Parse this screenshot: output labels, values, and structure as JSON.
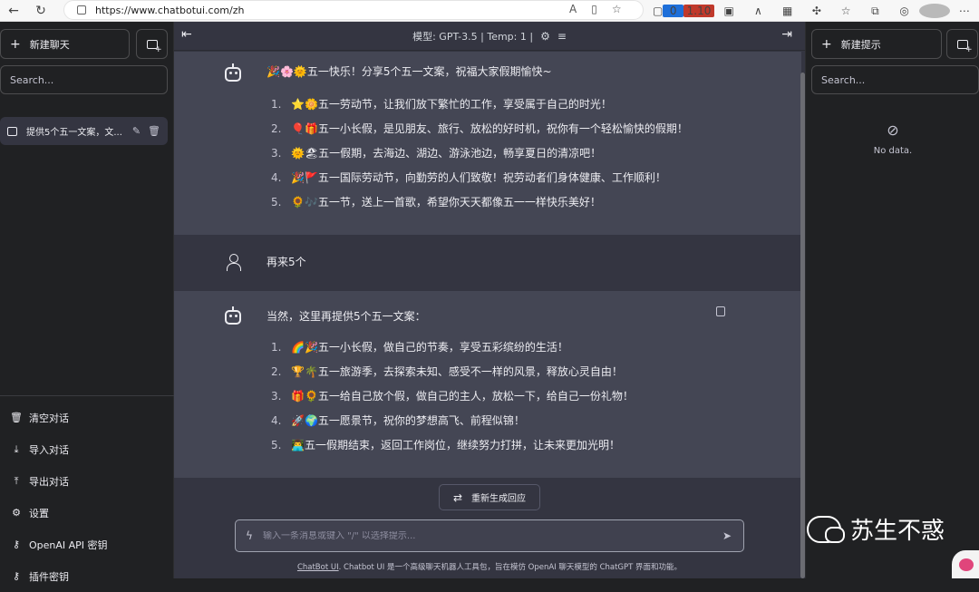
{
  "browser": {
    "url": "https://www.chatbotui.com/zh",
    "ext_badge_1": "0",
    "ext_badge_2": "1.10"
  },
  "sidebar": {
    "new_chat_label": "新建聊天",
    "search_placeholder": "Search...",
    "conversations": [
      {
        "title": "提供5个五一文案，文..."
      }
    ],
    "footer": [
      {
        "icon": "trash-icon",
        "label": "清空对话"
      },
      {
        "icon": "import-icon",
        "label": "导入对话"
      },
      {
        "icon": "export-icon",
        "label": "导出对话"
      },
      {
        "icon": "settings-icon",
        "label": "设置"
      },
      {
        "icon": "key-icon",
        "label": "OpenAI API 密钥"
      },
      {
        "icon": "plugin-key-icon",
        "label": "插件密钥"
      }
    ]
  },
  "header": {
    "model_label": "模型: GPT-3.5 | Temp: 1 |"
  },
  "messages": [
    {
      "role": "assistant",
      "intro": "🎉🌸🌞五一快乐！分享5个五一文案，祝福大家假期愉快~",
      "items": [
        "⭐🌼五一劳动节，让我们放下繁忙的工作，享受属于自己的时光！",
        "🎈🎁五一小长假，是见朋友、旅行、放松的好时机，祝你有一个轻松愉快的假期！",
        "🌞🏖五一假期，去海边、湖边、游泳池边，畅享夏日的清凉吧！",
        "🎉🚩五一国际劳动节，向勤劳的人们致敬！祝劳动者们身体健康、工作顺利！",
        "🌻🎶五一节，送上一首歌，希望你天天都像五一一样快乐美好！"
      ]
    },
    {
      "role": "user",
      "text": "再来5个"
    },
    {
      "role": "assistant",
      "intro": "当然，这里再提供5个五一文案：",
      "items": [
        "🌈🎉五一小长假，做自己的节奏，享受五彩缤纷的生活！",
        "🏆🌴五一旅游季，去探索未知、感受不一样的风景，释放心灵自由！",
        "🎁🌻五一给自己放个假，做自己的主人，放松一下，给自己一份礼物！",
        "🚀🌍五一愿景节，祝你的梦想高飞、前程似锦！",
        "👨‍💻五一假期结束，返回工作岗位，继续努力打拼，让未来更加光明！"
      ]
    }
  ],
  "regenerate_label": "重新生成回应",
  "input": {
    "placeholder": "输入一条消息或键入 \"/\" 以选择提示..."
  },
  "footnote": {
    "link": "ChatBot UI",
    "text": ". Chatbot UI 是一个高级聊天机器人工具包，旨在模仿 OpenAI 聊天模型的 ChatGPT 界面和功能。"
  },
  "rightbar": {
    "new_prompt_label": "新建提示",
    "search_placeholder": "Search...",
    "empty_text": "No data."
  },
  "watermark": {
    "text": "苏生不惑"
  }
}
